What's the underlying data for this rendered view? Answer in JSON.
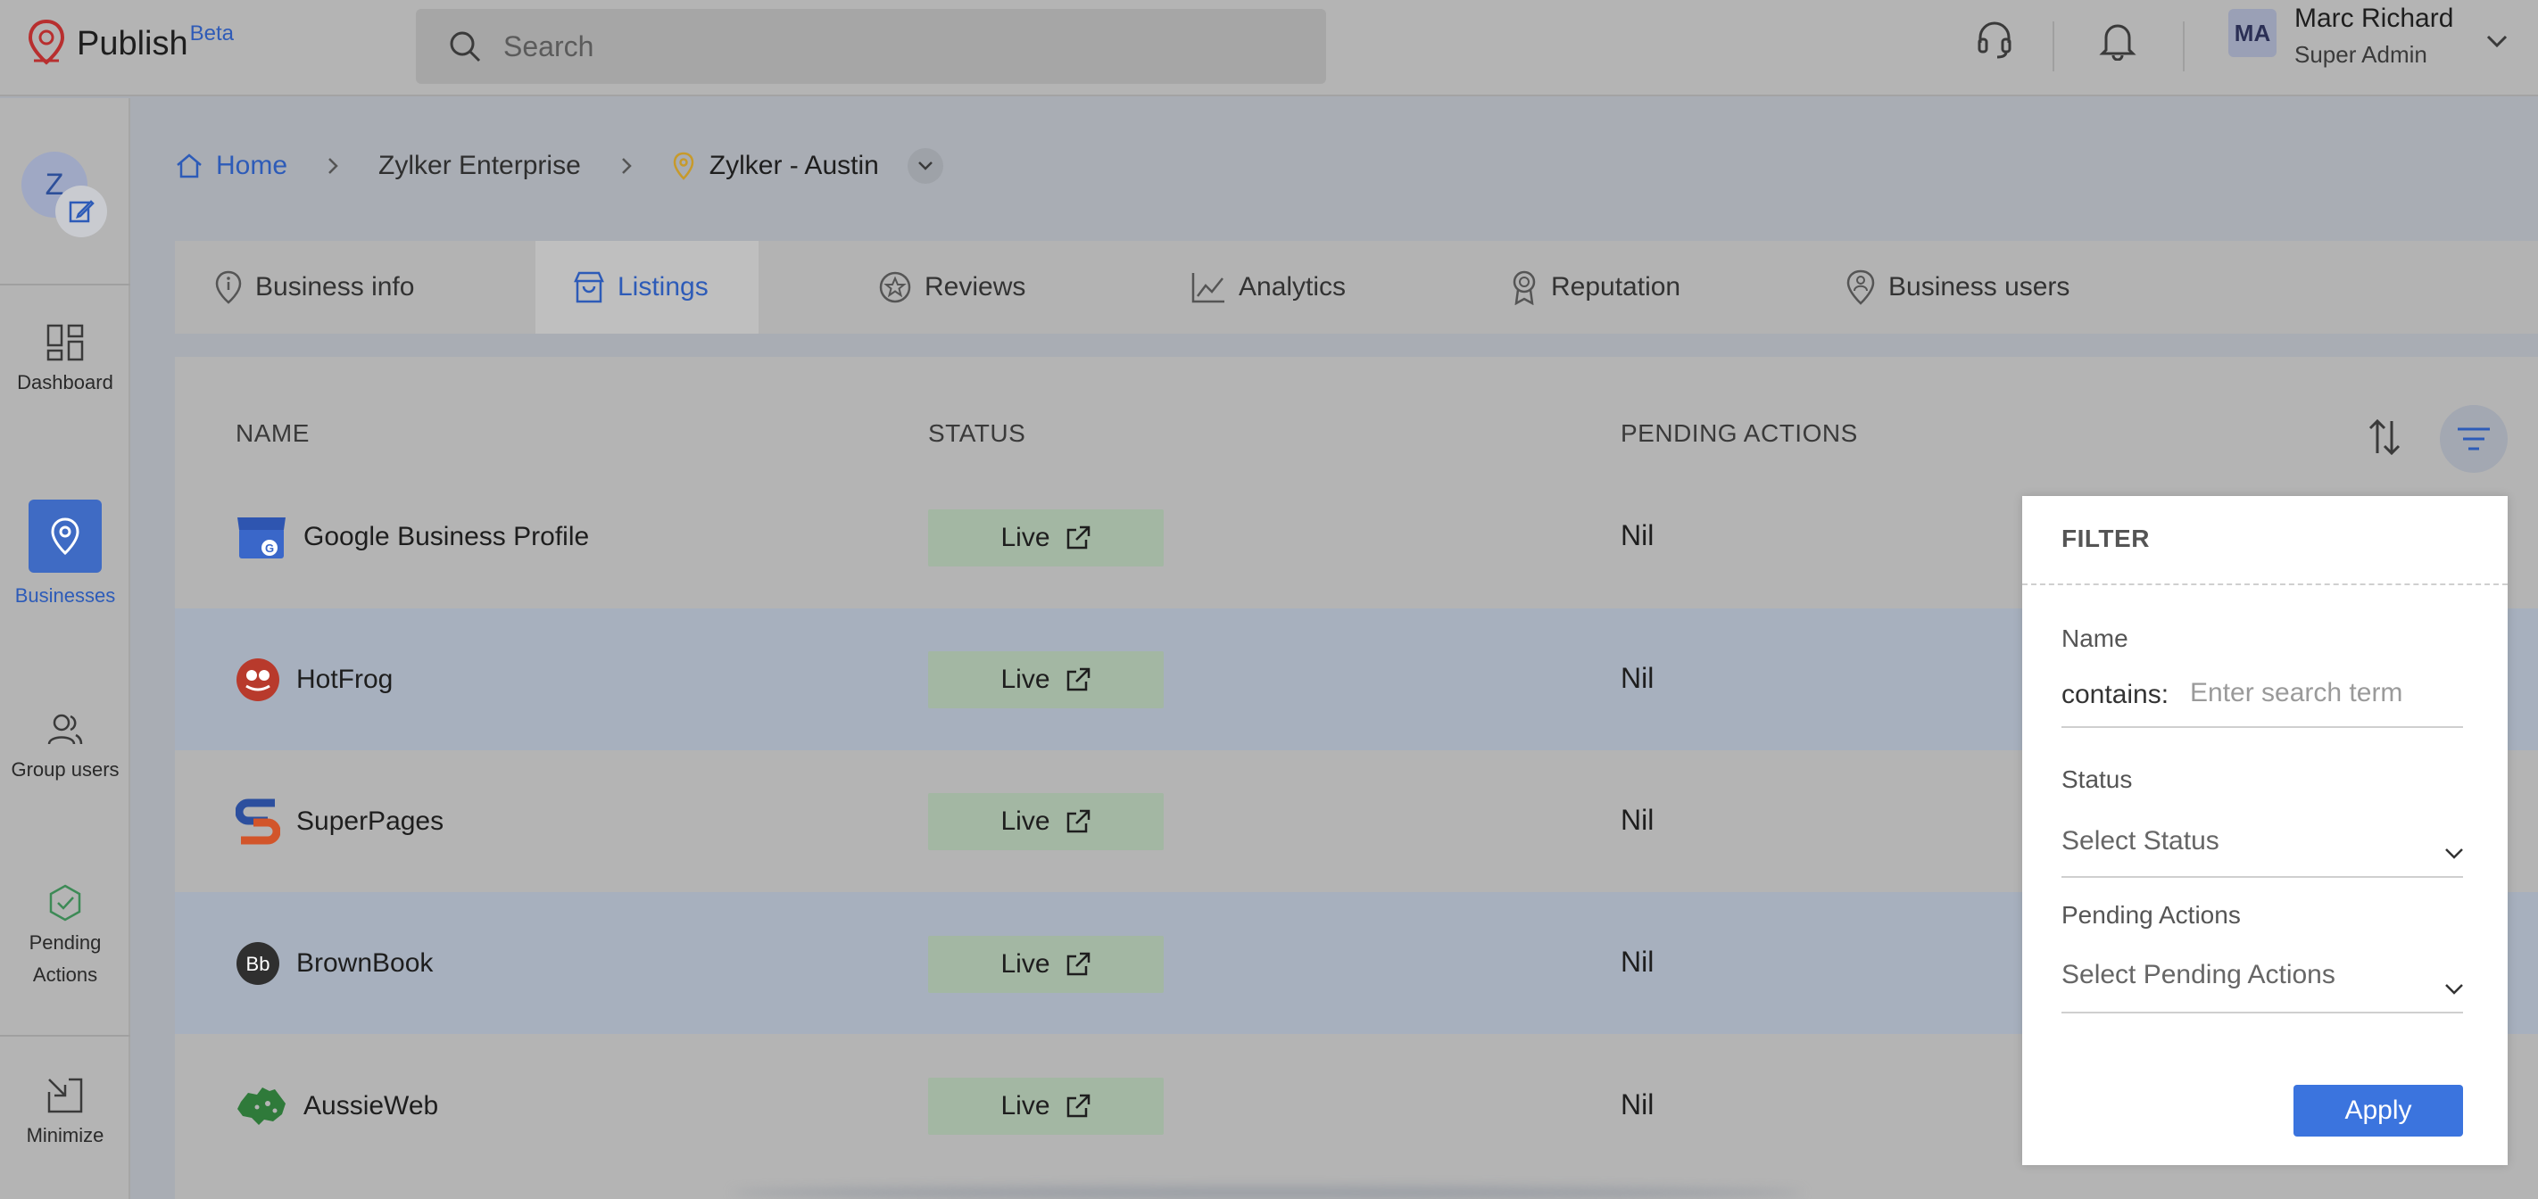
{
  "app": {
    "name": "Publish",
    "badge": "Beta"
  },
  "search": {
    "placeholder": "Search"
  },
  "user": {
    "initials": "MA",
    "name": "Marc Richard",
    "role": "Super Admin"
  },
  "sidebar": {
    "avatar_letter": "Z",
    "items": [
      {
        "label": "Dashboard"
      },
      {
        "label": "Businesses"
      },
      {
        "label": "Group users"
      },
      {
        "label": "Pending Actions"
      },
      {
        "label": "Minimize"
      }
    ]
  },
  "breadcrumb": {
    "home": "Home",
    "org": "Zylker Enterprise",
    "location": "Zylker - Austin"
  },
  "tabs": [
    {
      "label": "Business info"
    },
    {
      "label": "Listings"
    },
    {
      "label": "Reviews"
    },
    {
      "label": "Analytics"
    },
    {
      "label": "Reputation"
    },
    {
      "label": "Business users"
    }
  ],
  "table": {
    "headers": {
      "name": "NAME",
      "status": "STATUS",
      "pending": "PENDING ACTIONS"
    },
    "rows": [
      {
        "name": "Google Business Profile",
        "status": "Live",
        "pending": "Nil"
      },
      {
        "name": "HotFrog",
        "status": "Live",
        "pending": "Nil"
      },
      {
        "name": "SuperPages",
        "status": "Live",
        "pending": "Nil"
      },
      {
        "name": "BrownBook",
        "status": "Live",
        "pending": "Nil"
      },
      {
        "name": "AussieWeb",
        "status": "Live",
        "pending": "Nil"
      }
    ]
  },
  "filter": {
    "title": "FILTER",
    "name_label": "Name",
    "contains_label": "contains:",
    "name_placeholder": "Enter search term",
    "status_label": "Status",
    "status_placeholder": "Select Status",
    "pending_label": "Pending Actions",
    "pending_placeholder": "Select Pending Actions",
    "apply_label": "Apply"
  },
  "colors": {
    "accent": "#3b74de",
    "active_nav": "#3f6bc4",
    "live_badge": "#a3b7a3"
  }
}
